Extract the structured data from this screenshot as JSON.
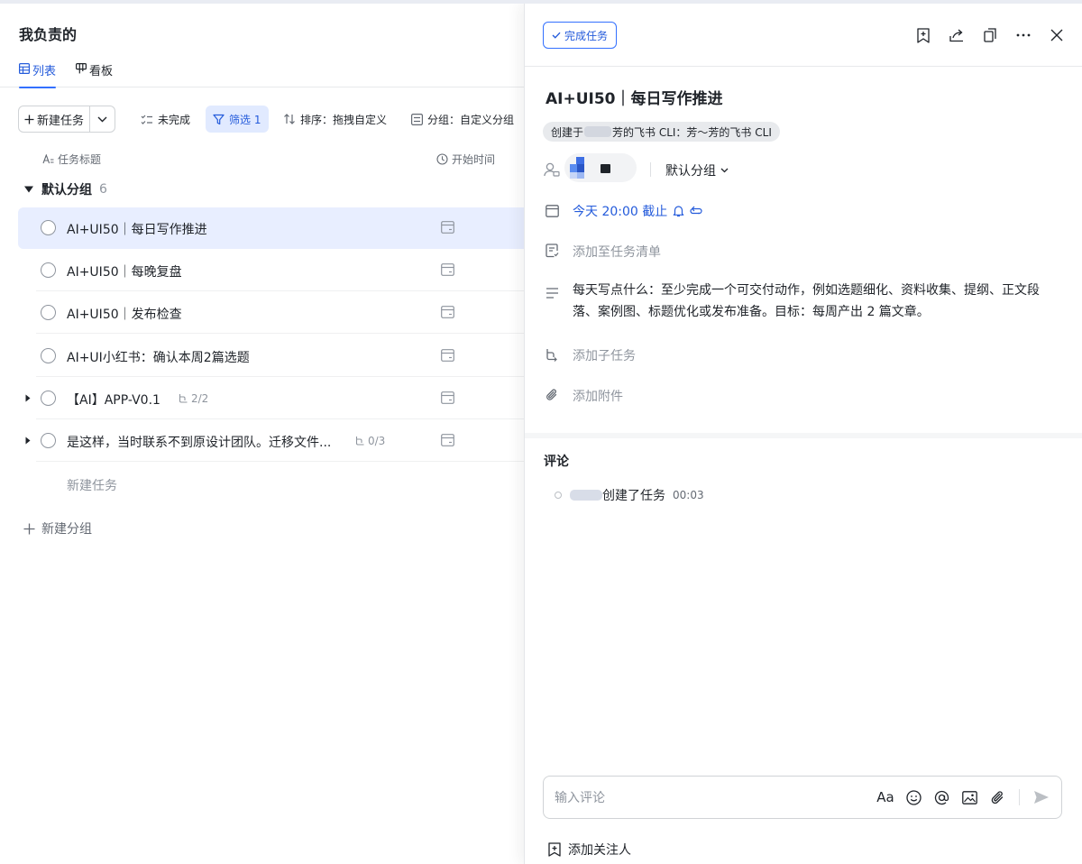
{
  "page": {
    "title": "我负责的",
    "tabs": [
      {
        "label": "列表",
        "icon": "table-icon",
        "active": true
      },
      {
        "label": "看板",
        "icon": "kanban-icon",
        "active": false
      }
    ]
  },
  "toolbar": {
    "new_task_label": "新建任务",
    "uncompleted_label": "未完成",
    "filter_label": "筛选 1",
    "sort_label": "排序：拖拽自定义",
    "group_label": "分组：自定义分组"
  },
  "columns": {
    "title_label": "任务标题",
    "start_label": "开始时间"
  },
  "group": {
    "name": "默认分组",
    "count": "6"
  },
  "tasks": [
    {
      "title": "AI+UI50｜每日写作推进",
      "selected": true,
      "expandable": false,
      "subtasks": ""
    },
    {
      "title": "AI+UI50｜每晚复盘",
      "selected": false,
      "expandable": false,
      "subtasks": ""
    },
    {
      "title": "AI+UI50｜发布检查",
      "selected": false,
      "expandable": false,
      "subtasks": ""
    },
    {
      "title": "AI+UI小红书：确认本周2篇选题",
      "selected": false,
      "expandable": false,
      "subtasks": ""
    },
    {
      "title": "【AI】APP-V0.1",
      "selected": false,
      "expandable": true,
      "subtasks": "2/2"
    },
    {
      "title": "是这样，当时联系不到原设计团队。迁移文件...",
      "selected": false,
      "expandable": true,
      "subtasks": "0/3"
    }
  ],
  "list_footer": {
    "new_task": "新建任务",
    "new_group": "新建分组"
  },
  "detail": {
    "complete_label": "完成任务",
    "title": "AI+UI50｜每日写作推进",
    "source_prefix": "创建于",
    "source_suffix": "芳的飞书 CLI：芳～芳的飞书 CLI",
    "group_select": "默认分组",
    "due": "今天 20:00 截止",
    "add_to_list": "添加至任务清单",
    "description": "每天写点什么：至少完成一个可交付动作，例如选题细化、资料收集、提纲、正文段落、案例图、标题优化或发布准备。目标：每周产出 2 篇文章。",
    "add_subtask": "添加子任务",
    "add_attachment": "添加附件"
  },
  "comments": {
    "title": "评论",
    "activity_text": "创建了任务",
    "activity_time": "00:03",
    "input_placeholder": "输入评论",
    "format_label": "Aa",
    "add_follower": "添加关注人"
  },
  "colors": {
    "accent": "#3370ff",
    "accent_text": "#245bdb",
    "selected_row_bg": "#e8eeff",
    "filter_active_bg": "#e1eaff"
  }
}
